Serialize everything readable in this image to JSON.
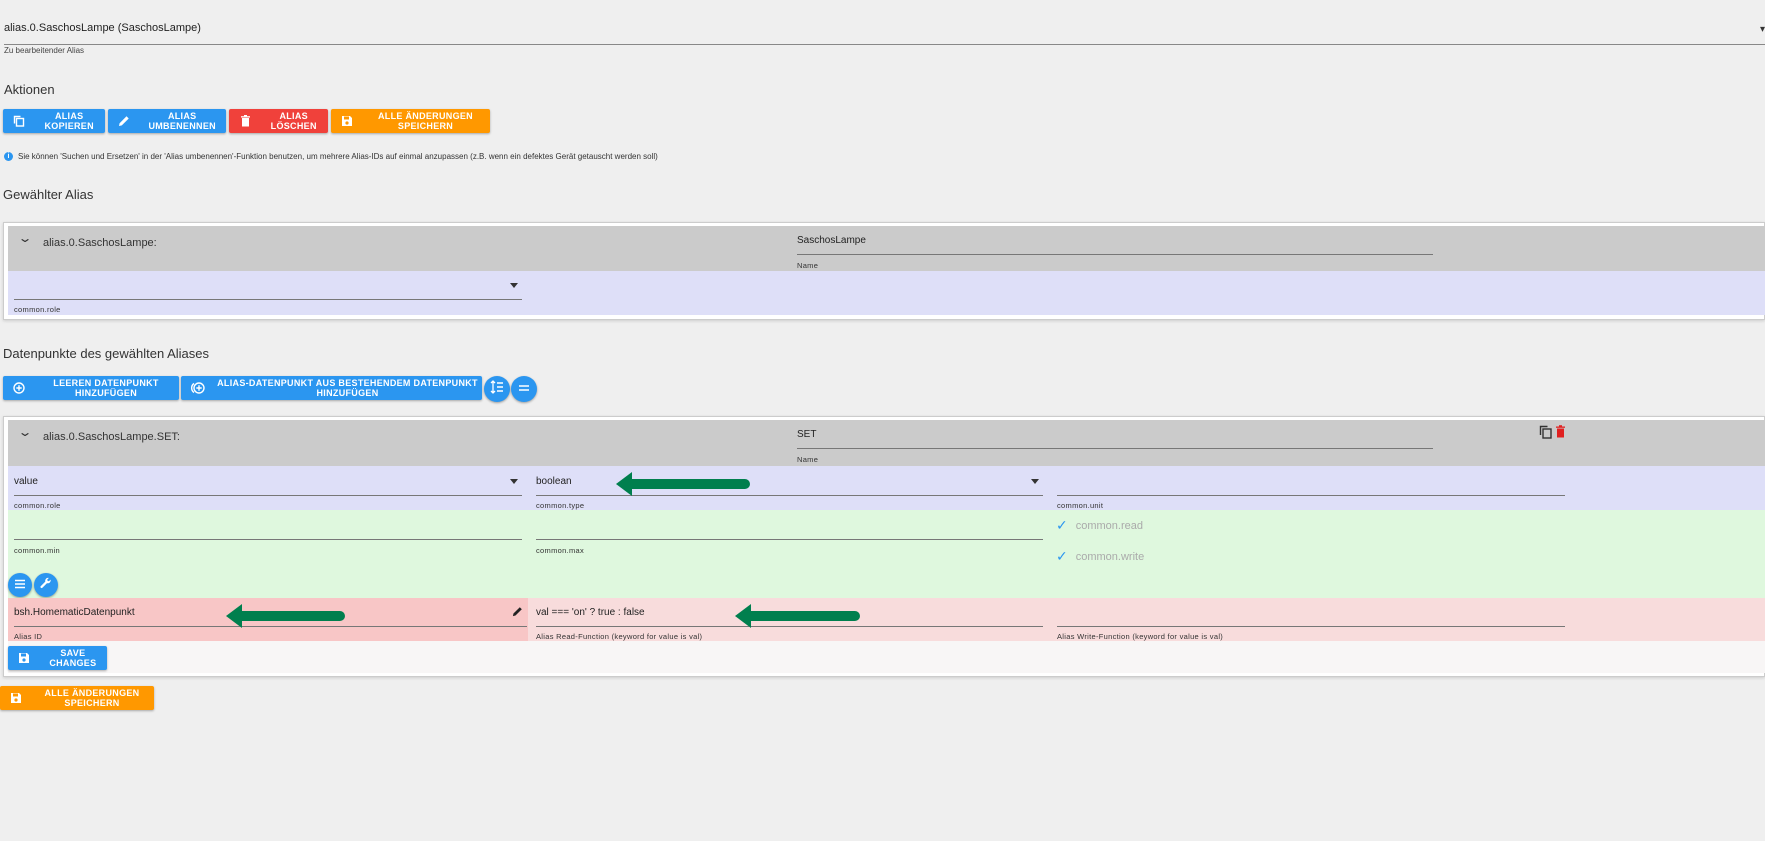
{
  "alias_select": {
    "value": "alias.0.SaschosLampe (SaschosLampe)",
    "helper": "Zu bearbeitender Alias"
  },
  "actions": {
    "title": "Aktionen",
    "copy_label": "ALIAS KOPIEREN",
    "rename_label": "ALIAS UMBENENNEN",
    "delete_label": "ALIAS LÖSCHEN",
    "save_all_label": "ALLE ÄNDERUNGEN SPEICHERN"
  },
  "info_text": "Sie können 'Suchen und Ersetzen' in der 'Alias umbenennen'-Funktion benutzen, um mehrere Alias-IDs auf einmal anzupassen (z.B. wenn ein defektes Gerät getauscht werden soll)",
  "selected_alias": {
    "title": "Gewählter Alias",
    "id": "alias.0.SaschosLampe:",
    "name_value": "SaschosLampe",
    "name_label": "Name",
    "role_value": "",
    "role_label": "common.role"
  },
  "datapoints": {
    "title": "Datenpunkte des gewählten Aliases",
    "add_empty_label": "LEEREN DATENPUNKT HINZUFÜGEN",
    "add_from_existing_label": "ALIAS-DATENPUNKT AUS BESTEHENDEM DATENPUNKT HINZUFÜGEN"
  },
  "datapoint": {
    "id": "alias.0.SaschosLampe.SET:",
    "name_value": "SET",
    "name_label": "Name",
    "role_value": "value",
    "role_label": "common.role",
    "type_value": "boolean",
    "type_label": "common.type",
    "unit_value": "",
    "unit_label": "common.unit",
    "min_value": "",
    "min_label": "common.min",
    "max_value": "",
    "max_label": "common.max",
    "read_label": "common.read",
    "write_label": "common.write",
    "alias_id_value": "bsh.HomematicDatenpunkt",
    "alias_id_label": "Alias ID",
    "read_fn_value": "val === 'on' ? true : false",
    "read_fn_label": "Alias Read-Function (keyword for value is val)",
    "write_fn_value": "",
    "write_fn_label": "Alias Write-Function (keyword for value is val)",
    "save_label": "SAVE CHANGES"
  },
  "bottom_save_label": "ALLE ÄNDERUNGEN SPEICHERN",
  "colors": {
    "primary": "#2b96f0",
    "danger": "#f0413b",
    "warning": "#ff9800",
    "annotation_arrow": "#007f4e"
  }
}
